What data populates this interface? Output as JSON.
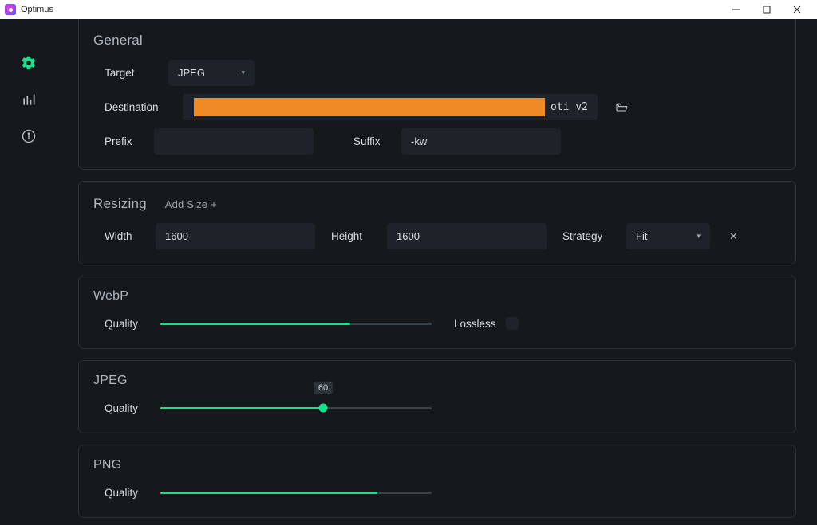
{
  "titlebar": {
    "app_name": "Optimus"
  },
  "sidebar": {
    "items": [
      {
        "name": "settings",
        "icon": "gear",
        "active": true
      },
      {
        "name": "stats",
        "icon": "bars",
        "active": false
      },
      {
        "name": "info",
        "icon": "info",
        "active": false
      }
    ]
  },
  "general": {
    "title": "General",
    "target_label": "Target",
    "target_value": "JPEG",
    "destination_label": "Destination",
    "destination_visible_suffix": "oti v2",
    "prefix_label": "Prefix",
    "prefix_value": "",
    "suffix_label": "Suffix",
    "suffix_value": "-kw"
  },
  "resizing": {
    "title": "Resizing",
    "add_size_label": "Add Size +",
    "width_label": "Width",
    "width_value": "1600",
    "height_label": "Height",
    "height_value": "1600",
    "strategy_label": "Strategy",
    "strategy_value": "Fit"
  },
  "webp": {
    "title": "WebP",
    "quality_label": "Quality",
    "quality_value": 70,
    "lossless_label": "Lossless",
    "lossless_checked": false
  },
  "jpeg": {
    "title": "JPEG",
    "quality_label": "Quality",
    "quality_value": 60,
    "quality_tooltip": "60"
  },
  "png": {
    "title": "PNG",
    "quality_label": "Quality",
    "quality_value": 80
  },
  "colors": {
    "accent": "#18e28f",
    "redaction": "#f08a24"
  }
}
